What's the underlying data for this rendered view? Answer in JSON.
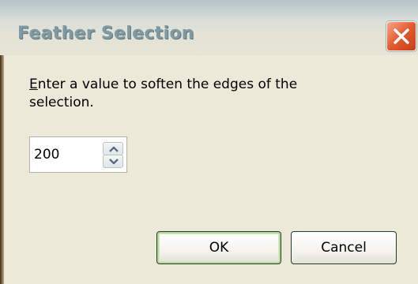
{
  "dialog": {
    "title": "Feather Selection",
    "close_label": "",
    "prompt_first_letter": "E",
    "prompt_rest": "nter a value to soften the edges of the selection.",
    "value": "200",
    "ok_label": "OK",
    "cancel_label": "Cancel"
  },
  "icons": {
    "close": "close-icon",
    "spin_up": "chevron-up-icon",
    "spin_down": "chevron-down-icon"
  },
  "colors": {
    "dialog_bg": "#ece9d8",
    "close_button": "#e35a30",
    "title_text": "#7f9aa3",
    "ok_focus": "#b9d89c"
  }
}
